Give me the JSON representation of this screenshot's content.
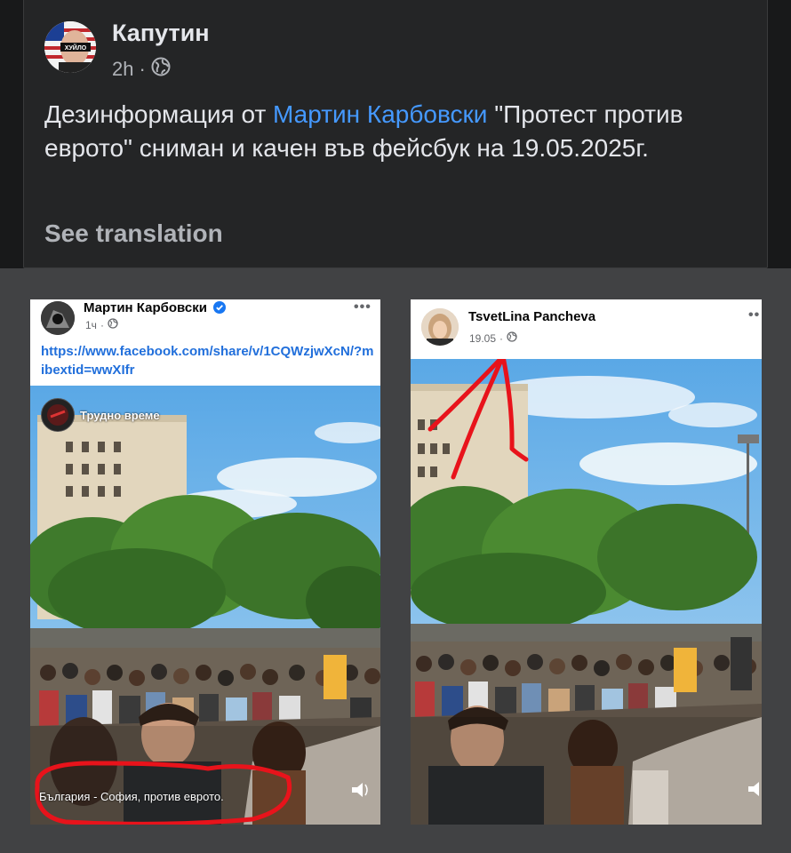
{
  "post": {
    "author": "Капутин",
    "avatar_badge": "ХУЙЛО",
    "time": "2h",
    "audience_icon": "globe-icon",
    "text_before": "Дезинформация от ",
    "text_link": "Мартин Карбовски",
    "text_after": " \"Протест против еврото\" сниман и качен във фейсбук на 19.05.2025г.",
    "see_translation": "See translation"
  },
  "left_screenshot": {
    "author": "Мартин Карбовски",
    "time": "1ч",
    "link": "https://www.facebook.com/share/v/1CQWzjwXcN/?mibextid=wwXIfr",
    "overlay_name": "Трудно време",
    "caption": "България - София, против еврото.",
    "more": "•••"
  },
  "right_screenshot": {
    "author": "TsvetLina Pancheva",
    "time": "19.05",
    "more": "••"
  },
  "colors": {
    "background": "#18191a",
    "card": "#242526",
    "link": "#4599ff",
    "annotation": "#e8131b"
  }
}
